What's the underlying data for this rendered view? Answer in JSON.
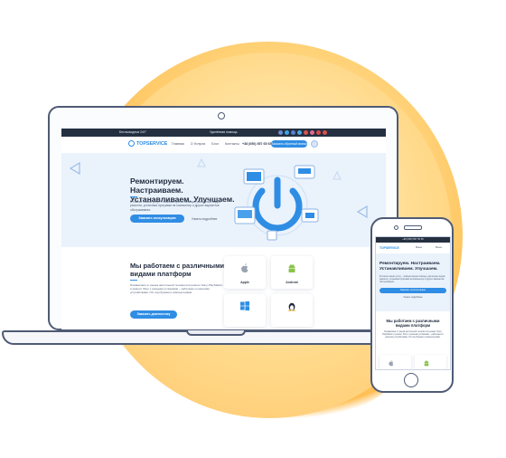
{
  "colors": {
    "accent": "#2f8de4",
    "dark": "#243040",
    "frame": "#4f5b75",
    "glow": "#ffc56a",
    "hero_bg": "#eaf2fc"
  },
  "laptop": {
    "topbar": {
      "hours": "Без выходных 24/7",
      "notice": "Удалённая помощь",
      "social_colors": [
        "#6c8bd6",
        "#3fa3e3",
        "#5c7fd0",
        "#4aa6e0",
        "#d9534f",
        "#e06b8f",
        "#d94b4b",
        "#d95050"
      ]
    },
    "nav": {
      "logo": "TOPSERVICE",
      "links": [
        "Главная",
        "О Услугах",
        "Блог",
        "Контакты"
      ],
      "phone": "+38 (050) 557 65 65",
      "cta": "Заказать обратный звонок"
    },
    "hero": {
      "title": "Ремонтируем. Настраиваем. Устанавливаем. Улучшаем.",
      "text": "В списке наших услуг – компьютерная помощь, различных видов ремонта, установка программ на компьютер и других вариантов обслуживания.",
      "button": "Заказать консультацию",
      "link": "Узнать подробнее"
    },
    "platforms": {
      "title": "Мы работаем с различными видами платформ",
      "text": "Независимо от рынка настольной техники или ремонт Sony PlayStation и ремонт Xbox с разными условиями – работаем со многими устройствами, ОС ноутбуками и компьютерами.",
      "button": "Заказать диагностику",
      "os": [
        {
          "name": "Apple",
          "icon": "apple-icon"
        },
        {
          "name": "Android",
          "icon": "android-icon"
        },
        {
          "name": "",
          "icon": "windows-icon"
        },
        {
          "name": "",
          "icon": "linux-icon"
        }
      ]
    }
  },
  "phone": {
    "topbar": "+38 (050) 557 65 65",
    "logo": "TOPSERVICE",
    "lang": "Меню",
    "menu": "Меню",
    "hero": {
      "title": "Ремонтируем. Настраиваем. Устанавливаем. Улучшаем.",
      "text": "В списке наших услуг – компьютерная помощь, различных видов ремонта, установка программ на компьютер и других вариантов обслуживания.",
      "button": "Заказать консультацию",
      "link": "Узнать подробнее"
    },
    "platforms": {
      "title": "Мы работаем с различными видами платформ",
      "text": "Независимо от рынка настольной техники или ремонт Sony PlayStation и ремонт Xbox с разными условиями – работаем со многими устройствами, ОС ноутбуками и компьютерами."
    }
  }
}
